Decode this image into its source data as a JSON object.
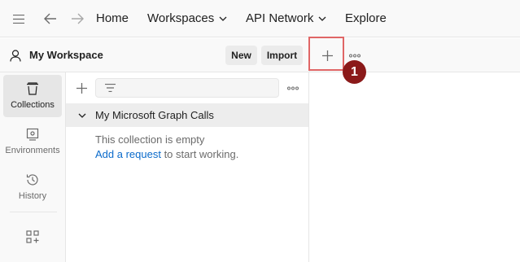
{
  "topbar": {
    "nav_items": [
      {
        "label": "Home"
      },
      {
        "label": "Workspaces",
        "has_dropdown": true
      },
      {
        "label": "API Network",
        "has_dropdown": true
      },
      {
        "label": "Explore"
      }
    ],
    "icons": [
      "hamburger-menu-icon",
      "back-arrow-icon",
      "forward-arrow-icon"
    ]
  },
  "workspace": {
    "title": "My Workspace",
    "new_label": "New",
    "import_label": "Import"
  },
  "tabs": {
    "add_tab_icon": "plus-icon",
    "more_icon": "more-horizontal-icon"
  },
  "annotation": {
    "step_number": "1",
    "highlight_color": "#e06666",
    "badge_color": "#8b1a1a"
  },
  "sidebar": {
    "items": [
      {
        "label": "Collections",
        "icon": "trash-bin-icon",
        "active": true
      },
      {
        "label": "Environments",
        "icon": "environment-icon",
        "active": false
      },
      {
        "label": "History",
        "icon": "history-icon",
        "active": false
      },
      {
        "label": "",
        "icon": "add-grid-icon",
        "active": false
      }
    ]
  },
  "collections": {
    "filter_placeholder": "",
    "items": [
      {
        "name": "My Microsoft Graph Calls",
        "expanded": true
      }
    ],
    "empty_message": "This collection is empty",
    "add_request_link": "Add a request",
    "empty_suffix": " to start working."
  },
  "colors": {
    "link": "#0b6bcb",
    "text_primary": "#212121",
    "text_secondary": "#6b6b6b",
    "active_bg": "#e6e6e6"
  }
}
